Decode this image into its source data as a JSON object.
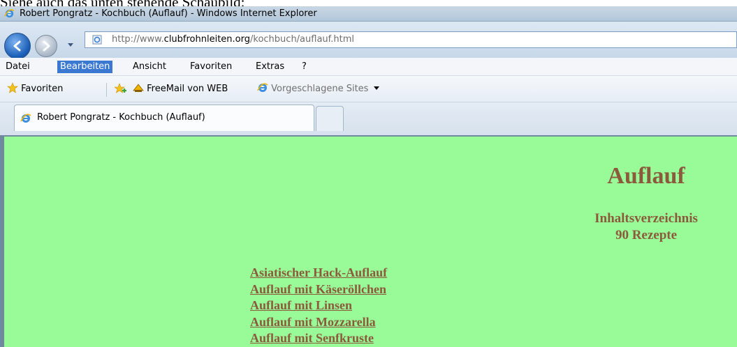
{
  "caption": "Siehe auch das unten stehende Schaubild:",
  "window": {
    "title": "Robert Pongratz - Kochbuch (Auflauf) - Windows Internet Explorer"
  },
  "address": {
    "prefix": "http://www.",
    "domain": "clubfrohnleiten.org",
    "path": "/kochbuch/auflauf.html"
  },
  "menu": {
    "items": [
      "Datei",
      "Bearbeiten",
      "Ansicht",
      "Favoriten",
      "Extras",
      "?"
    ],
    "active": "Bearbeiten"
  },
  "favorites_bar": {
    "favorites_label": "Favoriten",
    "freemail_label": "FreeMail von WEB",
    "suggested_label": "Vorgeschlagene Sites"
  },
  "tab": {
    "label": "Robert Pongratz - Kochbuch (Auflauf)"
  },
  "page": {
    "title": "Auflauf",
    "toc_heading": "Inhaltsverzeichnis",
    "recipe_count": "90 Rezepte",
    "recipes": [
      "Asiatischer Hack-Auflauf",
      "Auflauf mit Käseröllchen",
      "Auflauf mit Linsen",
      "Auflauf mit Mozzarella",
      "Auflauf mit Senfkruste"
    ]
  },
  "colors": {
    "page_background": "#98fb98",
    "link": "#8b5a3c",
    "menu_active": "#3a78d2"
  }
}
